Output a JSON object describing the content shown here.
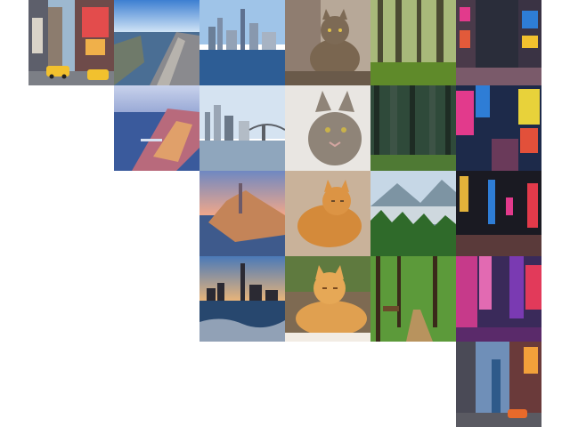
{
  "gallery": {
    "columns": [
      {
        "subject": "times-square-street",
        "tiles": 1
      },
      {
        "subject": "manhattan-aerial",
        "tiles": 2
      },
      {
        "subject": "nyc-skyline-waterfront",
        "tiles": 4
      },
      {
        "subject": "cat-portrait",
        "tiles": 4
      },
      {
        "subject": "forest",
        "tiles": 4
      },
      {
        "subject": "times-square-night",
        "tiles": 5
      }
    ]
  },
  "palette": {
    "sky": "#7fb2e6",
    "water": "#2f5f96",
    "forest": "#2f6a2a",
    "tabby": "#7a6650",
    "orange-cat": "#d48a3a",
    "neon-pink": "#e23a8c",
    "neon-blue": "#2e7dd6",
    "taxi": "#f2c12e"
  }
}
